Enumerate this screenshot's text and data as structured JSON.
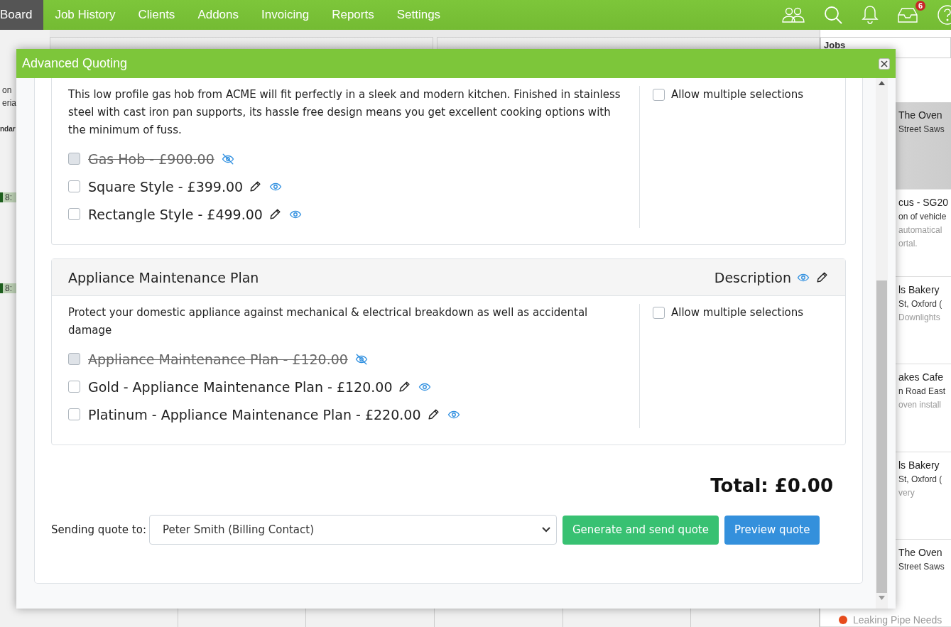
{
  "nav": {
    "items": [
      {
        "label": "Board",
        "selected": true
      },
      {
        "label": "Job History",
        "selected": false
      },
      {
        "label": "Clients",
        "selected": false
      },
      {
        "label": "Addons",
        "selected": false
      },
      {
        "label": "Invoicing",
        "selected": false
      },
      {
        "label": "Reports",
        "selected": false
      },
      {
        "label": "Settings",
        "selected": false
      }
    ],
    "inbox_badge": "6"
  },
  "background": {
    "panels": [
      "Jobs"
    ],
    "left_fragments": [
      "on",
      "eria",
      "ndar",
      "8:",
      "8:"
    ],
    "jobs": [
      {
        "selected": true,
        "lines": [
          "The Oven",
          "Street Saws"
        ]
      },
      {
        "selected": false,
        "lines": [
          "cus - SG20",
          "on of vehicle",
          "automatical",
          "ortal."
        ]
      },
      {
        "selected": false,
        "lines": [
          "ls Bakery",
          "St, Oxford (",
          "Downlights"
        ]
      },
      {
        "selected": false,
        "lines": [
          "akes Cafe",
          "n Road East",
          "oven install"
        ]
      },
      {
        "selected": false,
        "lines": [
          "ls Bakery",
          "St, Oxford (",
          "very"
        ]
      },
      {
        "selected": false,
        "lines": [
          "The Oven",
          "Street Saws"
        ]
      }
    ],
    "job_note": "Leaking Pipe Needs"
  },
  "modal": {
    "title": "Advanced Quoting",
    "sections": [
      {
        "description": "This low profile gas hob from ACME will fit perfectly in a sleek and modern kitchen. Finished in stainless steel with cast iron pan supports, its hassle free design means you get excellent cooking options with the minimum of fuss.",
        "allow_multiple": {
          "label": "Allow multiple selections",
          "checked": false
        },
        "options": [
          {
            "label": "Gas Hob - £900.00",
            "hidden": true,
            "checked": false
          },
          {
            "label": "Square Style - £399.00",
            "hidden": false,
            "checked": false
          },
          {
            "label": "Rectangle Style - £499.00",
            "hidden": false,
            "checked": false
          }
        ]
      },
      {
        "title": "Appliance Maintenance Plan",
        "description_label": "Description",
        "description": "Protect your domestic appliance against mechanical & electrical breakdown as well as accidental damage",
        "allow_multiple": {
          "label": "Allow multiple selections",
          "checked": false
        },
        "options": [
          {
            "label": "Appliance Maintenance Plan - £120.00",
            "hidden": true,
            "checked": false
          },
          {
            "label": "Gold - Appliance Maintenance Plan - £120.00",
            "hidden": false,
            "checked": false
          },
          {
            "label": "Platinum - Appliance Maintenance Plan - £220.00",
            "hidden": false,
            "checked": false
          }
        ]
      }
    ],
    "total": "Total: £0.00",
    "send_label": "Sending quote to:",
    "recipient": "Peter Smith (Billing Contact)",
    "buttons": [
      {
        "label": "Generate and send quote",
        "kind": "success"
      },
      {
        "label": "Preview quote",
        "kind": "info"
      }
    ]
  }
}
